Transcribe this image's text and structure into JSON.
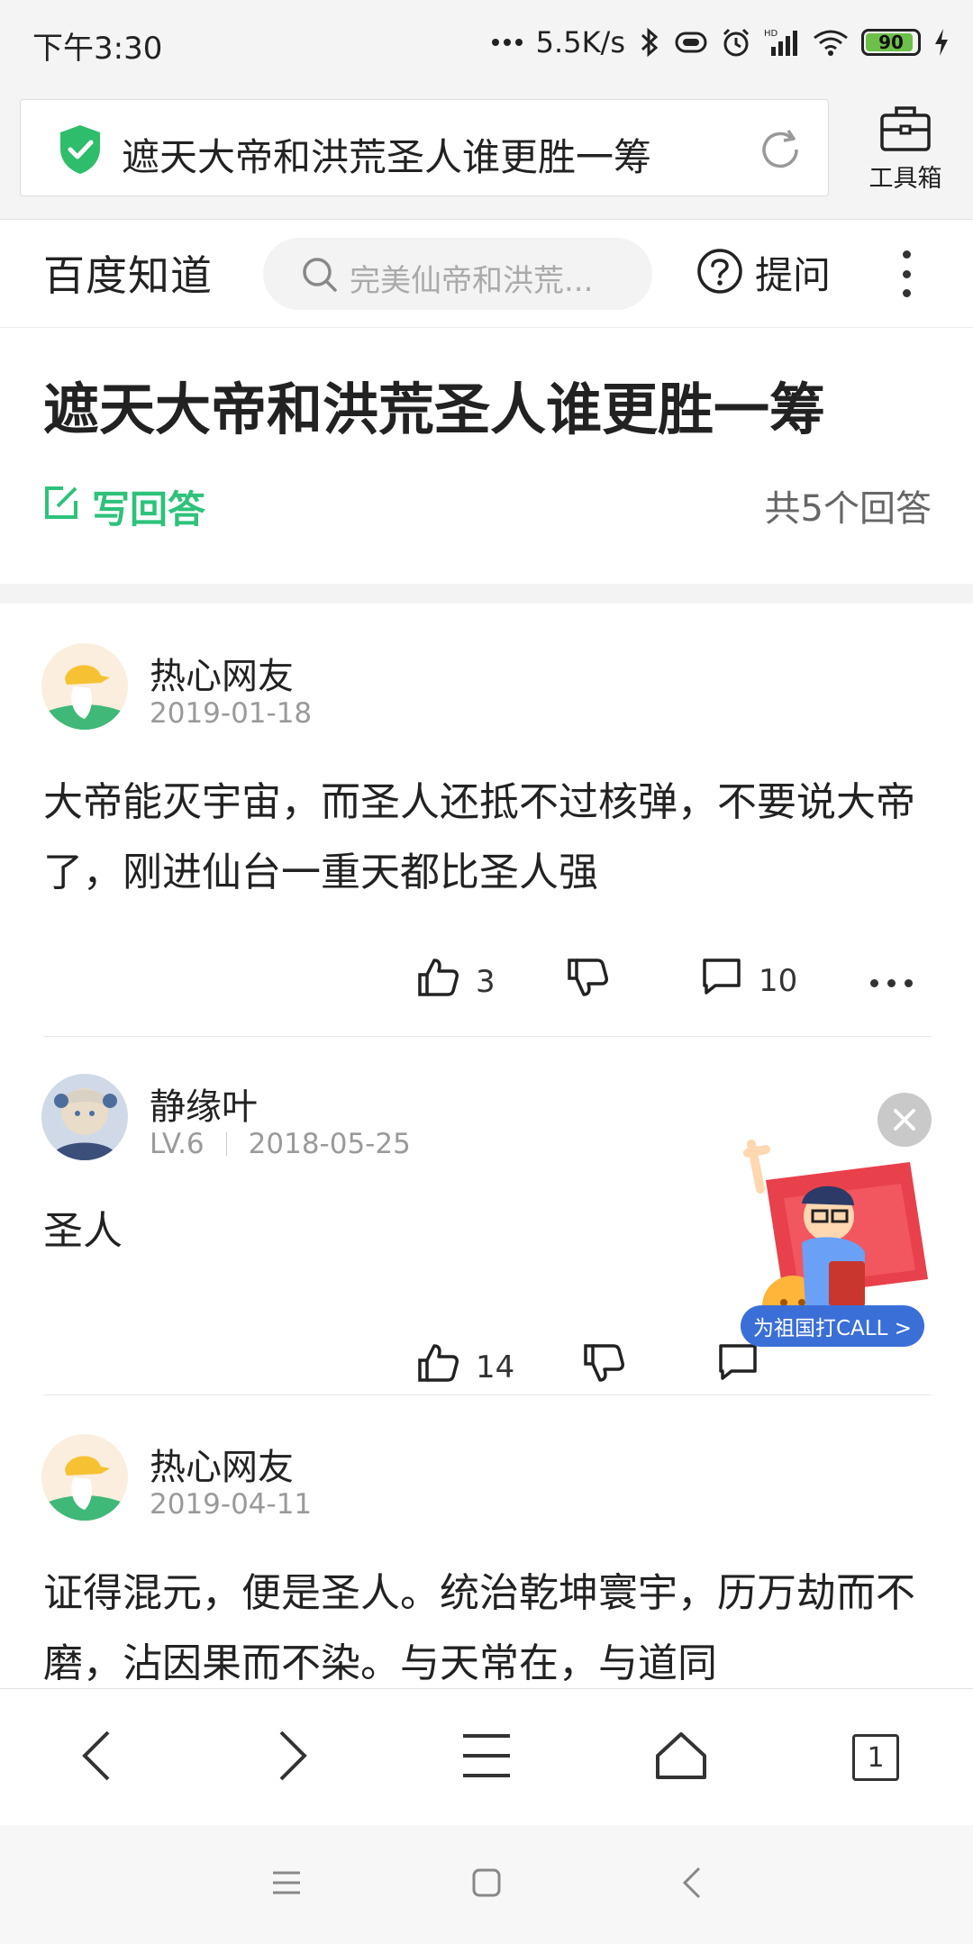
{
  "status_bar": {
    "time": "下午3:30",
    "network_speed": "5.5K/s",
    "battery": "90",
    "hd_label": "HD"
  },
  "browser": {
    "url_title": "遮天大帝和洪荒圣人谁更胜一筹",
    "toolbox_label": "工具箱",
    "tab_count": "1"
  },
  "site": {
    "logo": "百度知道",
    "search_placeholder": "完美仙帝和洪荒...",
    "ask_label": "提问"
  },
  "question": {
    "title": "遮天大帝和洪荒圣人谁更胜一筹",
    "write_answer": "写回答",
    "answer_count": "共5个回答"
  },
  "answers": [
    {
      "user": "热心网友",
      "level": "",
      "date": "2019-01-18",
      "text": "大帝能灭宇宙，而圣人还抵不过核弹，不要说大帝了，刚进仙台一重天都比圣人强",
      "likes": "3",
      "comments": "10"
    },
    {
      "user": "静缘叶",
      "level": "LV.6",
      "date": "2018-05-25",
      "text": "圣人",
      "likes": "14",
      "comments": ""
    },
    {
      "user": "热心网友",
      "level": "",
      "date": "2019-04-11",
      "text": "证得混元，便是圣人。统治乾坤寰宇，历万劫而不磨，沾因果而不染。与天常在，与道同",
      "likes": "",
      "comments": ""
    }
  ],
  "promo": {
    "button_label": "为祖国打CALL >"
  },
  "colors": {
    "accent_green": "#2ec27a",
    "promo_blue": "#3b6fd8"
  }
}
